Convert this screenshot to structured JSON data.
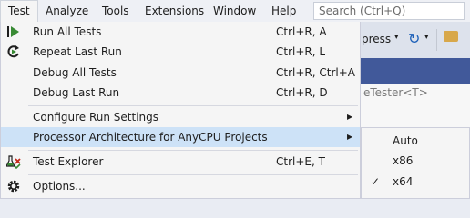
{
  "menubar": {
    "items": [
      {
        "label": "Test"
      },
      {
        "label": "Analyze"
      },
      {
        "label": "Tools"
      },
      {
        "label": "Extensions"
      },
      {
        "label": "Window"
      },
      {
        "label": "Help"
      }
    ],
    "search_placeholder": "Search (Ctrl+Q)"
  },
  "toolbar": {
    "config_label": "press",
    "config_arrow": "▾",
    "refresh_icon": "↻",
    "refresh_arrow": "▾"
  },
  "editor": {
    "code_text": "eTester<T>"
  },
  "test_menu": {
    "items": [
      {
        "label": "Run All Tests",
        "shortcut": "Ctrl+R, A",
        "icon": "run-all-icon"
      },
      {
        "label": "Repeat Last Run",
        "shortcut": "Ctrl+R, L",
        "icon": "repeat-run-icon"
      },
      {
        "label": "Debug All Tests",
        "shortcut": "Ctrl+R, Ctrl+A"
      },
      {
        "label": "Debug Last Run",
        "shortcut": "Ctrl+R, D"
      },
      {
        "label": "Configure Run Settings",
        "arrow": "▶"
      },
      {
        "label": "Processor Architecture for AnyCPU Projects",
        "arrow": "▶"
      },
      {
        "label": "Test Explorer",
        "shortcut": "Ctrl+E, T",
        "icon": "test-explorer-icon"
      },
      {
        "label": "Options...",
        "icon": "gear-icon"
      }
    ]
  },
  "architecture_submenu": {
    "items": [
      {
        "label": "Auto",
        "checked": false
      },
      {
        "label": "x86",
        "checked": false
      },
      {
        "label": "x64",
        "checked": true,
        "check_mark": "✓"
      }
    ]
  },
  "colors": {
    "highlight": "#cde2f7",
    "menu_background": "#f5f5f5",
    "accent_blue": "#41599a"
  }
}
